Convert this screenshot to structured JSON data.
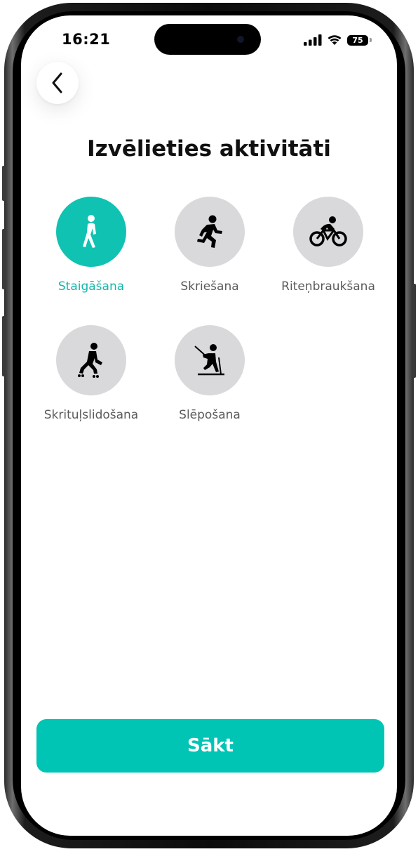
{
  "status_bar": {
    "time": "16:21",
    "battery": "75",
    "icons": [
      "signal-icon",
      "wifi-icon",
      "battery-icon"
    ]
  },
  "header": {
    "back_icon": "chevron-left-icon",
    "title": "Izvēlieties aktivitāti"
  },
  "activities": [
    {
      "label": "Staigāšana",
      "icon": "walking-icon",
      "selected": true
    },
    {
      "label": "Skriešana",
      "icon": "running-icon",
      "selected": false
    },
    {
      "label": "Riteņbraukšana",
      "icon": "cycling-icon",
      "selected": false
    },
    {
      "label": "Skrituļslidošana",
      "icon": "rollerblading-icon",
      "selected": false
    },
    {
      "label": "Slēpošana",
      "icon": "skiing-icon",
      "selected": false
    }
  ],
  "start_button": {
    "label": "Sākt"
  },
  "colors": {
    "accent": "#00c4b4",
    "selected_label": "#12b8aa",
    "unselected_circle": "#d9d9dc",
    "title": "#111111"
  }
}
